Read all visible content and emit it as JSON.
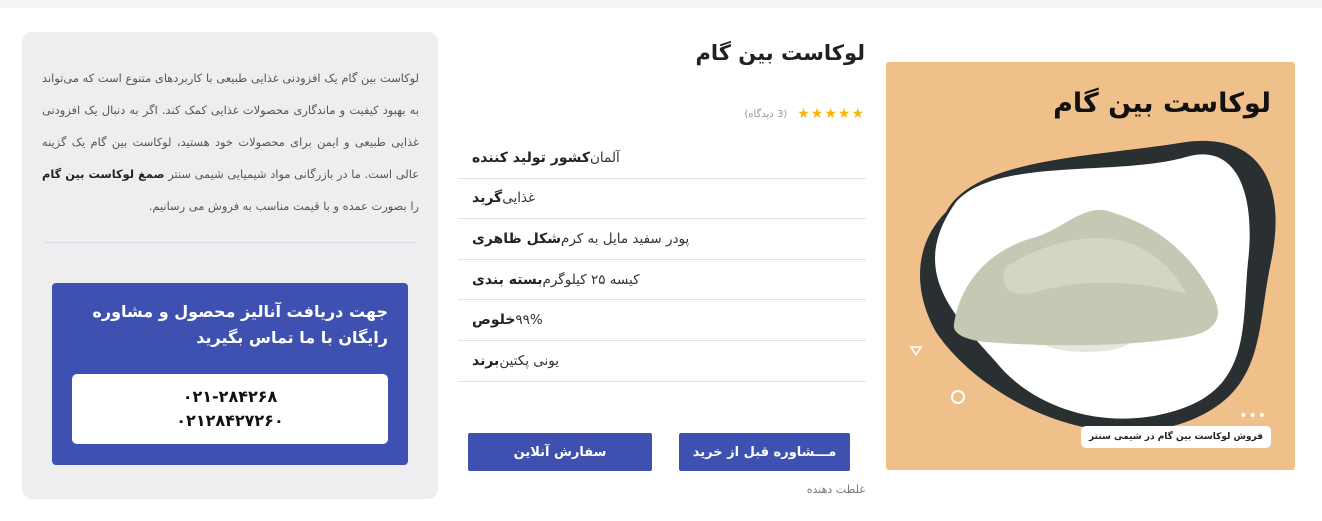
{
  "product": {
    "title": "لوکاست بین گام",
    "stars": "★★★★★",
    "reviews": "(3 دیدگاه)",
    "specs": [
      {
        "label": "کشور تولید کننده",
        "value": "آلمان"
      },
      {
        "label": "گرید",
        "value": "غذایی"
      },
      {
        "label": "شکل ظاهری",
        "value": "پودر سفید مایل به کرم"
      },
      {
        "label": "بسته بندی",
        "value": "کیسه ۲۵ کیلوگرم"
      },
      {
        "label": "خلوص",
        "value": "۹۹%"
      },
      {
        "label": "برند",
        "value": "یونی پکتین"
      }
    ],
    "consult_button": "مـــشاوره قبل از خرید",
    "order_button": "سفارش آنلاین",
    "report_link": "غلطت دهنده"
  },
  "image": {
    "title": "لوکاست بین گام",
    "caption": "فروش لوکاست بین گام در شیمی سنتر",
    "dots": "•••",
    "colors": {
      "background": "#f0c08b",
      "blob_dark": "#2a2f31",
      "powder": "#c5c8b2"
    }
  },
  "info": {
    "text_part1": "لوکاست بین گام یک افزودنی غذایی طبیعی با کاربردهای متنوع است که می‌تواند به بهبود کیفیت و ماندگاری محصولات غذایی کمک کند. اگر به دنبال یک افزودنی غذایی طبیعی و ایمن برای محصولات خود هستید، لوکاست بین گام یک گزینه عالی است. ما در بازرگانی مواد شیمیایی شیمی سنتر ",
    "text_bold": "صمغ لوکاست بین گام",
    "text_part2": " را بصورت عمده و با قیمت مناسب به فروش می رسانیم.",
    "contact_title": "جهت دریافت آنالیز محصول و مشاوره رایگان با ما تماس بگیرید",
    "phones": [
      "۰۲۱-۲۸۴۲۶۸",
      "۰۲۱۲۸۴۲۷۲۶۰"
    ]
  },
  "colors": {
    "accent": "#3f51b0",
    "star": "#f6b800",
    "panel": "#eeeef0"
  }
}
